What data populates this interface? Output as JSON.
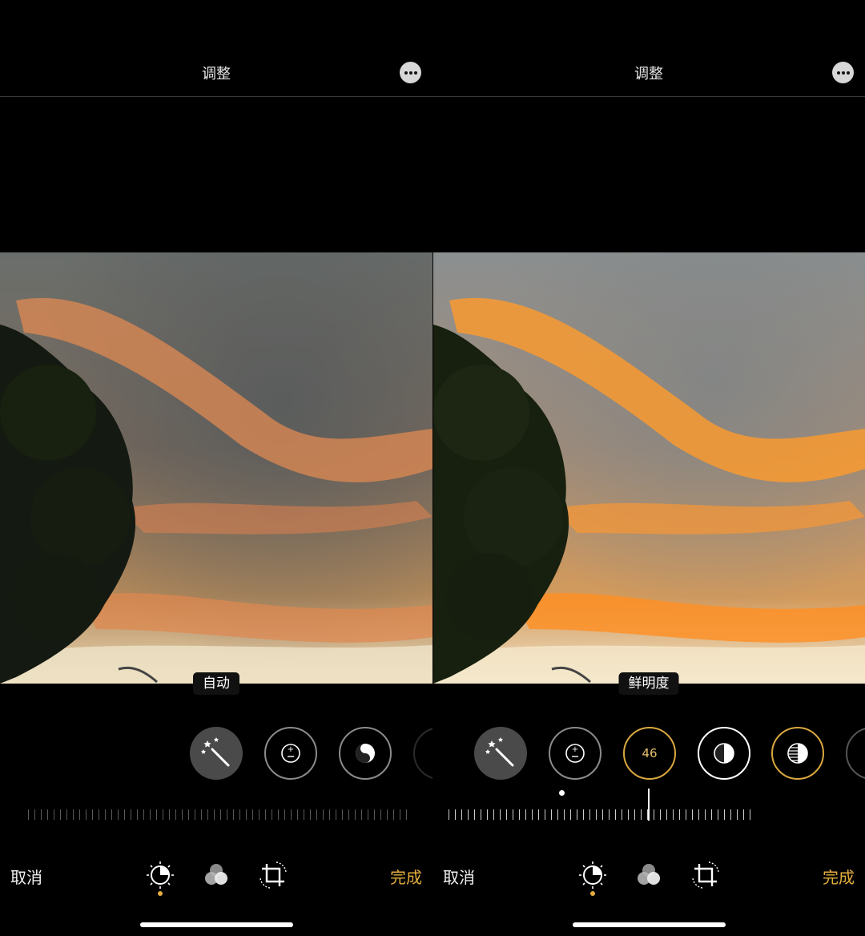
{
  "left_panel": {
    "header": {
      "title": "调整",
      "more_icon": "ellipsis-circle-icon"
    },
    "tool_label": "自动",
    "tools": [
      {
        "name": "auto-enhance",
        "icon": "magic-wand-icon",
        "selected": true
      },
      {
        "name": "exposure",
        "icon": "plus-minus-icon"
      },
      {
        "name": "brilliance",
        "icon": "yin-yang-icon"
      }
    ],
    "bottom": {
      "cancel": "取消",
      "done": "完成"
    },
    "tabs": [
      {
        "name": "adjust",
        "icon": "adjust-dial-icon",
        "active": true
      },
      {
        "name": "filters",
        "icon": "filters-circles-icon"
      },
      {
        "name": "crop",
        "icon": "crop-rotate-icon"
      }
    ]
  },
  "right_panel": {
    "header": {
      "title": "调整",
      "more_icon": "ellipsis-circle-icon"
    },
    "tool_label": "鲜明度",
    "tools": [
      {
        "name": "auto-enhance",
        "icon": "magic-wand-icon"
      },
      {
        "name": "exposure",
        "icon": "plus-minus-icon"
      },
      {
        "name": "vibrance",
        "value": "46",
        "selected": true
      },
      {
        "name": "contrast",
        "icon": "half-circle-icon"
      },
      {
        "name": "black-point",
        "icon": "striped-half-circle-icon"
      }
    ],
    "bottom": {
      "cancel": "取消",
      "done": "完成"
    },
    "tabs": [
      {
        "name": "adjust",
        "icon": "adjust-dial-icon",
        "active": true
      },
      {
        "name": "filters",
        "icon": "filters-circles-icon"
      },
      {
        "name": "crop",
        "icon": "crop-rotate-icon"
      }
    ]
  },
  "colors": {
    "accent": "#e3ad3d",
    "background": "#000000",
    "sky_orange": "#ff9a2a"
  }
}
